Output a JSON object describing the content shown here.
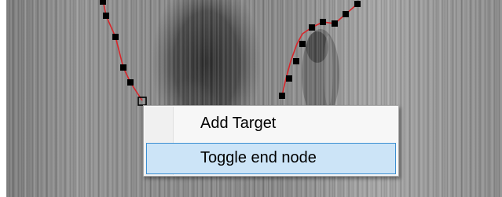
{
  "image_view": {
    "content": "grayscale sonar image with two red contour lines made of black square nodes"
  },
  "context_menu": {
    "items": [
      {
        "label": "Add Target",
        "highlighted": false
      },
      {
        "label": "Toggle end node",
        "highlighted": true
      }
    ]
  },
  "colors": {
    "contour_line": "#d9262b",
    "node_fill": "#000000",
    "menu_highlight_bg": "#cce4f7",
    "menu_highlight_border": "#3c8fd2"
  }
}
